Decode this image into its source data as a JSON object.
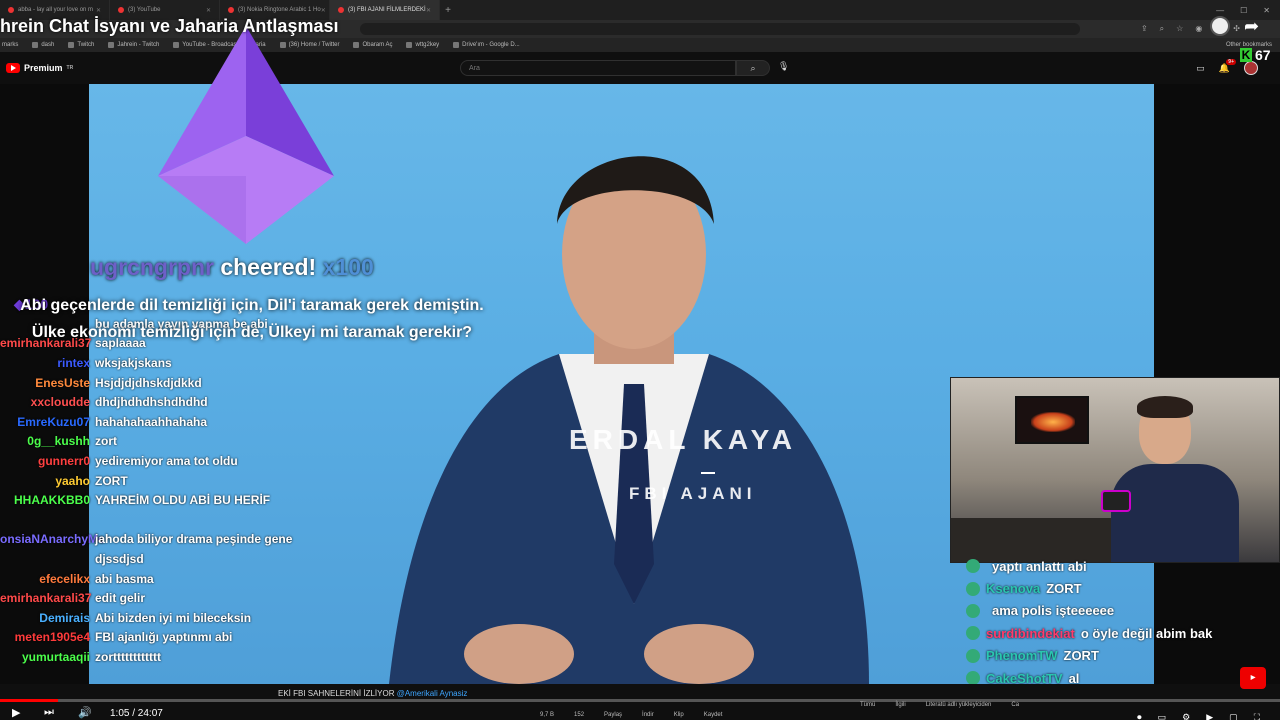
{
  "browser": {
    "tabs": [
      {
        "label": "abba - lay all your love on m"
      },
      {
        "label": "(3) YouTube"
      },
      {
        "label": "(3) Nokia Ringtone Arabic 1 Ho"
      },
      {
        "label": "(3) FBI AJANI FİLMLERDEKİ"
      }
    ],
    "new_tab": "+",
    "bookmarks": [
      "marks",
      "dash",
      "Twitch",
      "Jahrein - Twitch",
      "YouTube - Broadcas...",
      "aria",
      "(36) Home / Twitter",
      "Obaram Aç",
      "wttg2key",
      "Drive'ım - Google D..."
    ],
    "other_bookmarks": "Other bookmarks"
  },
  "youtube": {
    "logo": "Premium",
    "logo_sup": "TR",
    "search_placeholder": "Ara",
    "search_icon": "search-icon",
    "mic_icon": "mic-icon",
    "notif_count": "9+"
  },
  "stream": {
    "title": "hrein Chat İsyanı ve Jaharia Antlaşması",
    "k_count": "67",
    "cheer_user": "ugrcngrpnr",
    "cheer_text": "cheered!",
    "cheer_x": "x100",
    "bits": "100",
    "tts_message": "Abi geçenlerde dil temizliği için, Dil'i taramak gerek demiştin. Ülke ekonomi temizliği için de, Ülkeyi mi taramak gerekir?"
  },
  "video": {
    "host_name": "ERDAL KAYA",
    "host_title": "FBI AJANI"
  },
  "chat_left": [
    {
      "user": "",
      "msg": "bu adamla yayın yapma be abi",
      "color": "#a0d9ff"
    },
    {
      "user": "emirhankarali37",
      "msg": "saplaaaa",
      "color": "#ff4a4a"
    },
    {
      "user": "rintex",
      "msg": "wksjakjskans",
      "color": "#3b5bff"
    },
    {
      "user": "EnesUste",
      "msg": "Hsjdjdjdhskdjdkkd",
      "color": "#ff8a3d"
    },
    {
      "user": "xxcloudde",
      "msg": "dhdjhdhdhshdhdhd",
      "color": "#ff5050"
    },
    {
      "user": "EmreKuzu07",
      "msg": "hahahahaahhahaha",
      "color": "#2a6aff"
    },
    {
      "user": "0g__kushh",
      "msg": "zort",
      "color": "#4cff4c"
    },
    {
      "user": "gunnerr0",
      "msg": "yediremiyor ama tot oldu",
      "color": "#ff4040"
    },
    {
      "user": "yaaho",
      "msg": "ZORT",
      "color": "#ffcc33"
    },
    {
      "user": "HHAAKKBB0",
      "msg": "YAHREİM OLDU ABİ BU HERİF",
      "color": "#4cff4c"
    },
    {
      "user": "",
      "msg": "",
      "color": "#ffffff"
    },
    {
      "user": "onsiaNAnarchyMe",
      "msg": "jahoda biliyor drama peşinde gene",
      "color": "#7a6cff"
    },
    {
      "user": "",
      "msg": "djssdjsd",
      "color": "#ffffff"
    },
    {
      "user": "efecelikx",
      "msg": "abi basma",
      "color": "#ff7a3d"
    },
    {
      "user": "emirhankarali37",
      "msg": "edit gelir",
      "color": "#ff4a4a"
    },
    {
      "user": "Demirais",
      "msg": "Abi bizden iyi mi bileceksin",
      "color": "#4ab0ff"
    },
    {
      "user": "meten1905e4",
      "msg": "FBI ajanlığı yaptınmı abi",
      "color": "#ff3b3b"
    },
    {
      "user": "yumurtaaqii",
      "msg": "zortttttttttttt",
      "color": "#4cff4c"
    }
  ],
  "chat_right": [
    {
      "user": "",
      "msg": "yaptı anlattı abi",
      "color": "#ffffff"
    },
    {
      "user": "Ksenova",
      "msg": "ZORT",
      "color": "#2ac6b0"
    },
    {
      "user": "",
      "msg": "ama polis işteeeeee",
      "color": "#5a4cff"
    },
    {
      "user": "surdibindekiat",
      "msg": "o öyle değil abim bak",
      "color": "#ff3b6b"
    },
    {
      "user": "PhenomTW",
      "msg": "ZORT",
      "color": "#2ac6b0"
    },
    {
      "user": "CakeShotTV",
      "msg": "al",
      "color": "#2ac6b0"
    },
    {
      "user": "",
      "msg": "ZORT JAHO ZORT",
      "color": "#5a4cff"
    }
  ],
  "player": {
    "time": "1:05 / 24:07",
    "progress": 0.045,
    "scroll_title": "EKİ FBI SAHNELERİNİ İZLİYOR",
    "scroll_link": "@Amerikali Aynasiz",
    "actions": [
      "9,7 B",
      "152",
      "Paylaş",
      "İndir",
      "Klip",
      "Kaydet"
    ],
    "tags": [
      "Tümü",
      "İlgili",
      "Literatü adlı yükleyiciden",
      "Ca"
    ]
  },
  "colors": {
    "accent": "#ff0000",
    "bits_purple": "#6d3bd8",
    "video_bg": "#5aaee4"
  }
}
